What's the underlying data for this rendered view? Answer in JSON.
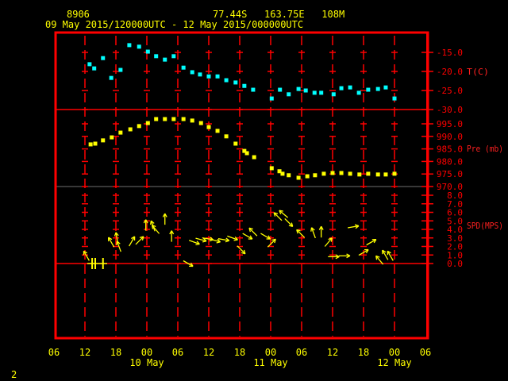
{
  "header": {
    "station_id": "8906",
    "location": "77.44S   163.75E   108M",
    "period": "09 May 2015/120000UTC - 12 May 2015/000000UTC"
  },
  "footer": {
    "page_number": "2"
  },
  "colors": {
    "frame": "#ff0000",
    "temperature": "#00ffff",
    "pressure": "#ffff00",
    "wind": "#ffff00",
    "text": "#ffff00",
    "axis_text": "#ff0000"
  },
  "chart_data": {
    "type": "scatter",
    "title": "09 May 2015/120000UTC - 12 May 2015/000000UTC",
    "x_unit": "hours since 09 May 2015 12UTC",
    "xlim": [
      -6,
      66
    ],
    "x_ticks": [
      {
        "t": -6,
        "label": "06"
      },
      {
        "t": 0,
        "label": "12"
      },
      {
        "t": 6,
        "label": "18"
      },
      {
        "t": 12,
        "label": "00"
      },
      {
        "t": 18,
        "label": "06"
      },
      {
        "t": 24,
        "label": "12"
      },
      {
        "t": 30,
        "label": "18"
      },
      {
        "t": 36,
        "label": "00"
      },
      {
        "t": 42,
        "label": "06"
      },
      {
        "t": 48,
        "label": "12"
      },
      {
        "t": 54,
        "label": "18"
      },
      {
        "t": 60,
        "label": "00"
      },
      {
        "t": 66,
        "label": "06"
      }
    ],
    "date_labels": [
      {
        "t": 12,
        "label": "10 May"
      },
      {
        "t": 36,
        "label": "11 May"
      },
      {
        "t": 60,
        "label": "12 May"
      }
    ],
    "panels": [
      {
        "name": "temperature",
        "label": "T(C)",
        "ylim": [
          -30,
          -15
        ],
        "ticks": [
          "-15.0",
          "-20.0",
          "-25.0",
          "-30.0"
        ],
        "tick_values": [
          -15,
          -20,
          -25,
          -30
        ],
        "series": {
          "t": [
            0.9,
            1.8,
            3.5,
            5.1,
            6.9,
            8.6,
            10.5,
            12.2,
            13.8,
            15.5,
            17.2,
            19.1,
            20.8,
            22.3,
            24.0,
            25.7,
            27.4,
            29.2,
            30.9,
            32.6,
            36.2,
            37.8,
            39.5,
            41.4,
            42.8,
            44.5,
            45.8,
            48.2,
            49.7,
            51.4,
            53.1,
            54.9,
            56.8,
            58.3,
            60.0
          ],
          "values": [
            -18.1,
            -19.2,
            -16.5,
            -21.7,
            -19.6,
            -13.1,
            -13.5,
            -14.8,
            -16.0,
            -16.9,
            -16.0,
            -19.0,
            -20.2,
            -20.8,
            -21.3,
            -21.3,
            -22.3,
            -22.9,
            -23.8,
            -24.8,
            -27.1,
            -24.8,
            -26.0,
            -24.6,
            -25.0,
            -25.6,
            -25.6,
            -26.0,
            -24.4,
            -24.2,
            -25.6,
            -24.8,
            -24.6,
            -24.2,
            -27.1
          ]
        }
      },
      {
        "name": "pressure",
        "label": "Pre (mb)",
        "ylim": [
          970,
          995
        ],
        "ticks": [
          "995.0",
          "990.0",
          "985.0",
          "980.0",
          "975.0",
          "970.0"
        ],
        "tick_values": [
          995,
          990,
          985,
          980,
          975,
          970
        ],
        "series": {
          "t": [
            1.1,
            2.0,
            3.5,
            5.2,
            6.9,
            8.8,
            10.5,
            12.2,
            13.8,
            15.5,
            17.2,
            19.1,
            20.8,
            22.5,
            24.0,
            25.7,
            27.4,
            29.2,
            30.9,
            31.4,
            32.8,
            36.2,
            37.7,
            38.3,
            39.5,
            41.4,
            43.1,
            44.6,
            46.3,
            48.0,
            49.7,
            51.4,
            53.2,
            54.9,
            56.8,
            58.3,
            60.0
          ],
          "values": [
            986.8,
            987.1,
            988.4,
            989.6,
            991.5,
            992.8,
            994.1,
            995.3,
            996.9,
            996.9,
            996.9,
            996.9,
            996.3,
            995.3,
            993.7,
            992.2,
            990.0,
            987.1,
            984.2,
            983.3,
            981.7,
            977.3,
            976.1,
            975.1,
            974.5,
            973.5,
            974.1,
            974.5,
            975.1,
            975.4,
            975.4,
            975.1,
            974.8,
            975.1,
            974.8,
            974.8,
            975.1
          ]
        }
      },
      {
        "name": "wind_speed",
        "label": "SPD(MPS)",
        "ylim": [
          0,
          8
        ],
        "ticks": [
          "8.0",
          "7.0",
          "6.0",
          "5.0",
          "4.0",
          "3.0",
          "2.0",
          "1.0",
          "0.0"
        ],
        "tick_values": [
          8,
          7,
          6,
          5,
          4,
          3,
          2,
          1,
          0
        ],
        "calm_t": [
          1.4,
          2.0,
          3.5
        ],
        "arrows": {
          "t": [
            0.3,
            5.1,
            6.2,
            6.6,
            9.1,
            10.6,
            11.8,
            13.2,
            13.7,
            15.5,
            16.8,
            20.0,
            21.2,
            22.5,
            23.8,
            25.2,
            26.9,
            28.6,
            30.3,
            31.5,
            32.6,
            35.0,
            36.2,
            37.4,
            38.5,
            39.5,
            41.8,
            44.3,
            45.8,
            47.2,
            48.2,
            50.3,
            52.0,
            54.0,
            55.5,
            57.1,
            58.2,
            59.2
          ],
          "speed": [
            0.9,
            2.5,
            3.0,
            2.0,
            2.6,
            2.7,
            4.5,
            4.4,
            4.0,
            5.2,
            3.2,
            0.0,
            2.5,
            2.8,
            2.9,
            2.7,
            2.8,
            3.0,
            1.6,
            3.2,
            3.7,
            3.2,
            2.4,
            5.5,
            5.8,
            4.8,
            3.5,
            3.6,
            3.7,
            2.5,
            0.8,
            0.9,
            4.3,
            1.3,
            2.5,
            0.4,
            1.0,
            0.9
          ],
          "direction_deg": [
            330,
            330,
            350,
            340,
            30,
            45,
            0,
            340,
            320,
            0,
            0,
            120,
            110,
            105,
            100,
            105,
            100,
            110,
            135,
            120,
            315,
            120,
            45,
            315,
            310,
            135,
            315,
            340,
            0,
            40,
            90,
            90,
            80,
            60,
            60,
            320,
            330,
            330
          ]
        }
      }
    ]
  }
}
